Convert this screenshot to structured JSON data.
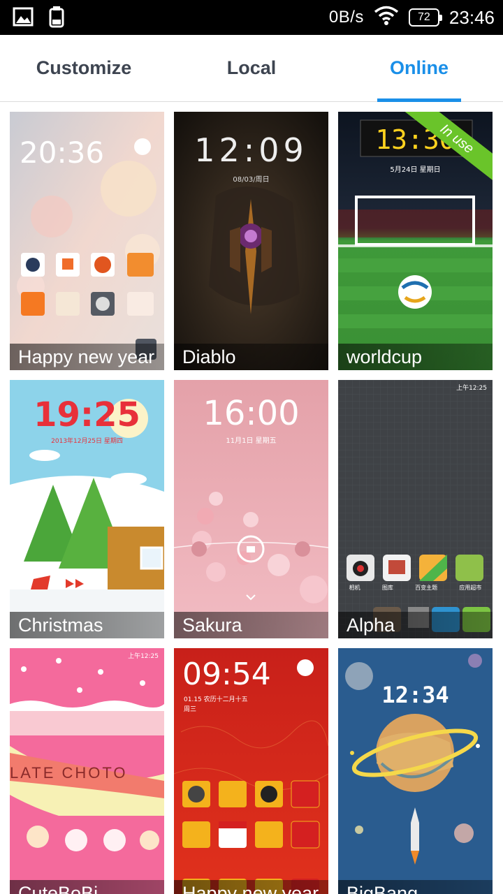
{
  "status_bar": {
    "icons": [
      "image-icon",
      "clipboard-icon",
      "wifi-icon"
    ],
    "net_speed": "0B/s",
    "battery": "72",
    "time": "23:46"
  },
  "tabs": [
    {
      "label": "Customize",
      "active": false
    },
    {
      "label": "Local",
      "active": false
    },
    {
      "label": "Online",
      "active": true
    }
  ],
  "themes": [
    {
      "name": "Happy new year",
      "preview_time": "20:36"
    },
    {
      "name": "Diablo",
      "preview_time": "12:09",
      "preview_date": "08/03/周日"
    },
    {
      "name": "worldcup",
      "preview_time": "13:30",
      "preview_date": "5月24日  星期日",
      "badge": "In use"
    },
    {
      "name": "Christmas",
      "preview_time": "19:25",
      "preview_date": "2013年12月25日  星期四"
    },
    {
      "name": "Sakura",
      "preview_time": "16:00",
      "preview_date": "11月1日  星期五"
    },
    {
      "name": "Alpha",
      "preview_status_time": "上午12:25",
      "preview_apps": [
        "相机",
        "图库",
        "百变主题",
        "应用超市"
      ]
    },
    {
      "name": "CuteBoBi",
      "preview_status_time": "上午12:25",
      "preview_banner": "LATE  CHOTO"
    },
    {
      "name": "Happy new year",
      "preview_time": "09:54",
      "preview_date": "01.15 农历十二月十五",
      "preview_weekday": "周三"
    },
    {
      "name": "BigBang",
      "preview_time": "12:34"
    }
  ]
}
